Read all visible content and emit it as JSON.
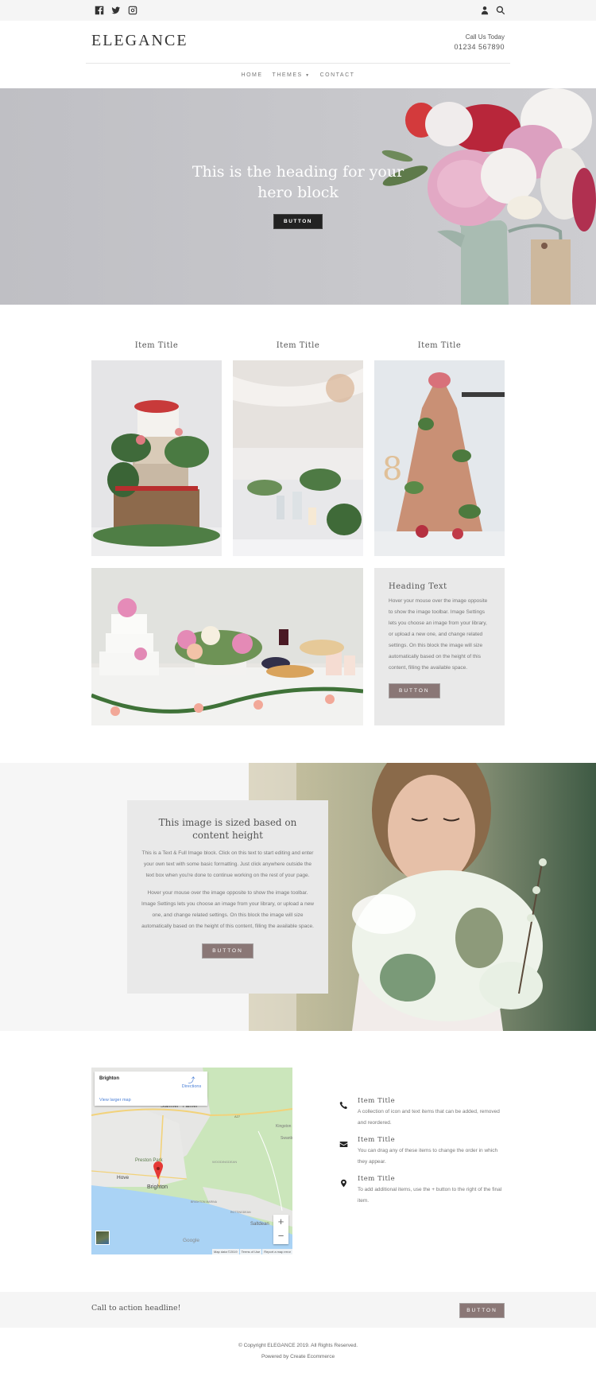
{
  "topbar": {
    "social_icons": [
      "facebook-icon",
      "twitter-icon",
      "instagram-icon"
    ],
    "right_icons": [
      "user-icon",
      "search-icon"
    ]
  },
  "header": {
    "logo": "ELEGANCE",
    "call_label": "Call Us Today",
    "phone": "01234 567890"
  },
  "nav": {
    "items": [
      {
        "label": "HOME"
      },
      {
        "label": "THEMES",
        "has_dropdown": true
      },
      {
        "label": "CONTACT"
      }
    ]
  },
  "hero": {
    "heading": "This is the heading for your hero block",
    "button": "BUTTON"
  },
  "items": [
    {
      "title": "Item Title",
      "image": "tiered wedding cake with flowers on wood stump"
    },
    {
      "title": "Item Title",
      "image": "wedding table setting under chandelier"
    },
    {
      "title": "Item Title",
      "image": "naked cupcake tower with flowers"
    }
  ],
  "wide_image": "wedding dessert table with cake and flowers",
  "panel": {
    "heading": "Heading Text",
    "body": "Hover your mouse over the image opposite to show the image toolbar. Image Settings lets you choose an image from your library, or upload a new one, and change related settings. On this block the image will size automatically based on the height of this content, filling the available space.",
    "button": "BUTTON"
  },
  "text_full_image": {
    "heading": "This image is sized based on content height",
    "paragraph1": "This is a Text & Full Image block. Click on this text to start editing and enter your own text with some basic formatting. Just click anywhere outside the text box when you're done to continue working on the rest of your page.",
    "paragraph2": "Hover your mouse over the image opposite to show the image toolbar. Image Settings lets you choose an image from your library, or upload a new one, and change related settings. On this block the image will size automatically based on the height of this content, filling the available space.",
    "button": "BUTTON",
    "image": "bride holding white bouquet"
  },
  "map": {
    "place": "Brighton",
    "directions": "Directions",
    "view_larger": "View larger map",
    "labels": [
      "Stanmer",
      "Falmer",
      "Kingston",
      "Swanb",
      "Preston Park",
      "WOODINGDEAN",
      "Hove",
      "Brighton",
      "BRIGHTON MARINA",
      "ROTTINGDEAN",
      "Saltdean",
      "A27"
    ],
    "zoom_in": "+",
    "zoom_out": "−",
    "google": "Google",
    "footer": [
      "Map data ©2019",
      "Terms of Use",
      "Report a map error"
    ]
  },
  "features": [
    {
      "icon": "phone-icon",
      "title": "Item Title",
      "text": "A collection of icon and text items that can be added, removed and reordered."
    },
    {
      "icon": "envelope-icon",
      "title": "Item Title",
      "text": "You can drag any of these items to change the order in which they appear."
    },
    {
      "icon": "map-marker-icon",
      "title": "Item Title",
      "text": "To add additional items, use the + button to the right of the final item."
    }
  ],
  "cta": {
    "headline": "Call to action headline!",
    "button": "BUTTON"
  },
  "footer": {
    "copyright": "© Copyright ELEGANCE 2019. All Rights Reserved.",
    "powered": "Powered by Create Ecommerce"
  },
  "colors": {
    "accent_button": "#8a7776",
    "dark_button": "#222222",
    "panel_bg": "#e9e9e9",
    "topbar_bg": "#f5f5f5"
  }
}
